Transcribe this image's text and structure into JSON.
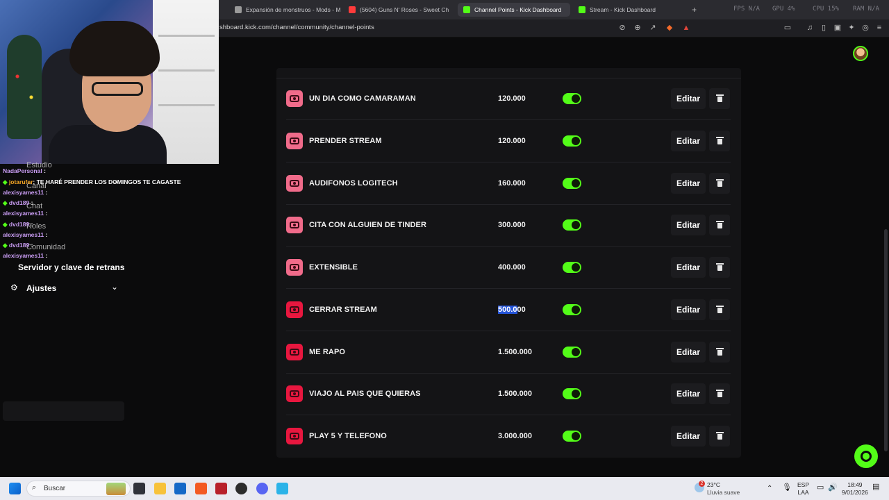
{
  "browser": {
    "tabs": [
      {
        "title": "Expansión de monstruos - Mods - M",
        "color": "#9a9a9a",
        "active": false
      },
      {
        "title": "(5604) Guns N' Roses - Sweet Ch",
        "color": "#ff3b3b",
        "active": false
      },
      {
        "title": "Channel Points - Kick Dashboard",
        "color": "#53fc18",
        "active": true
      },
      {
        "title": "Stream - Kick Dashboard",
        "color": "#53fc18",
        "active": false
      }
    ],
    "new_tab": "+",
    "url": "shboard.kick.com/channel/community/channel-points",
    "stats": {
      "fps": "FPS N/A",
      "gpu": "GPU 4%",
      "cpu": "CPU 15%",
      "ram": "RAM N/A"
    }
  },
  "chat": [
    {
      "user": "NadaPersonal",
      "msg": ":",
      "green": false
    },
    {
      "user": "jotarufer",
      "msg": ": TE HARÉ PRENDER LOS DOMINGOS TE CAGASTE",
      "green": false
    },
    {
      "user": "alexisyames11",
      "msg": ":",
      "green": false
    },
    {
      "user": "dvd189",
      "msg": ":",
      "green": true
    },
    {
      "user": "alexisyames11",
      "msg": ":",
      "green": false
    },
    {
      "user": "dvd189",
      "msg": ":",
      "green": true
    },
    {
      "user": "alexisyames11",
      "msg": ":",
      "green": false
    },
    {
      "user": "dvd189",
      "msg": ":",
      "green": true
    },
    {
      "user": "alexisyames11",
      "msg": ":",
      "green": false
    }
  ],
  "sidebar": {
    "ghost_items": [
      "Estudio",
      "Canal",
      "Chat",
      "Roles",
      "Comunidad"
    ],
    "server_key": "Servidor y clave de retrans",
    "settings": "Ajustes"
  },
  "rewards": [
    {
      "name": "UN DIA COMO CAMARAMAN",
      "cost": "120.000",
      "enabled": true,
      "color": "#f06b8a"
    },
    {
      "name": "PRENDER STREAM",
      "cost": "120.000",
      "enabled": true,
      "color": "#f06b8a"
    },
    {
      "name": "AUDIFONOS LOGITECH",
      "cost": "160.000",
      "enabled": true,
      "color": "#f06b8a"
    },
    {
      "name": "CITA CON ALGUIEN DE TINDER",
      "cost": "300.000",
      "enabled": true,
      "color": "#f06b8a"
    },
    {
      "name": "EXTENSIBLE",
      "cost": "400.000",
      "enabled": true,
      "color": "#f06b8a"
    },
    {
      "name": "CERRAR STREAM",
      "cost_selected": "500.0",
      "cost_rest": "00",
      "enabled": true,
      "color": "#e8173f"
    },
    {
      "name": "ME RAPO",
      "cost": "1.500.000",
      "enabled": true,
      "color": "#e8173f"
    },
    {
      "name": "VIAJO AL PAIS QUE QUIERAS",
      "cost": "1.500.000",
      "enabled": true,
      "color": "#e8173f"
    },
    {
      "name": "PLAY 5 Y TELEFONO",
      "cost": "3.000.000",
      "enabled": true,
      "color": "#e8173f"
    }
  ],
  "edit_label": "Editar",
  "taskbar": {
    "search_placeholder": "Buscar",
    "weather_temp": "23°C",
    "weather_desc": "Lluvia suave",
    "weather_badge": "2",
    "lang_top": "ESP",
    "lang_bottom": "LAA",
    "time": "18:49",
    "date": "9/01/2026"
  },
  "colors": {
    "accent": "#53fc18",
    "selection": "#2554d8"
  }
}
